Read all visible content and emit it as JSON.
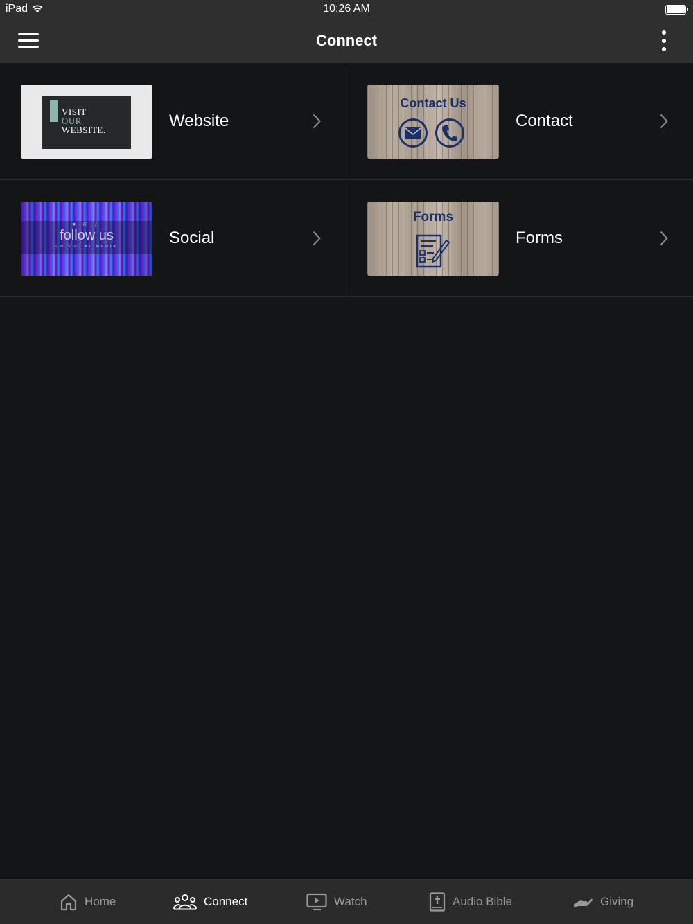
{
  "status": {
    "device": "iPad",
    "time": "10:26 AM"
  },
  "nav": {
    "title": "Connect"
  },
  "tiles": [
    {
      "label": "Website",
      "thumb": {
        "lines": [
          "VISIT",
          "OUR",
          "WEBSITE."
        ]
      }
    },
    {
      "label": "Contact",
      "thumb": {
        "heading": "Contact Us"
      }
    },
    {
      "label": "Social",
      "thumb": {
        "title": "follow us",
        "subtitle": "ON SOCIAL MEDIA"
      }
    },
    {
      "label": "Forms",
      "thumb": {
        "heading": "Forms"
      }
    }
  ],
  "tabs": [
    {
      "label": "Home",
      "icon": "home-icon",
      "active": false
    },
    {
      "label": "Connect",
      "icon": "people-icon",
      "active": true
    },
    {
      "label": "Watch",
      "icon": "play-screen-icon",
      "active": false
    },
    {
      "label": "Audio Bible",
      "icon": "bible-icon",
      "active": false
    },
    {
      "label": "Giving",
      "icon": "giving-hand-icon",
      "active": false
    }
  ],
  "colors": {
    "background": "#141517",
    "bar": "#2f2f30",
    "tab_bar": "#2b2b2c",
    "inactive_tab": "#9a9a9a",
    "wood_text": "#1b2f6b"
  }
}
